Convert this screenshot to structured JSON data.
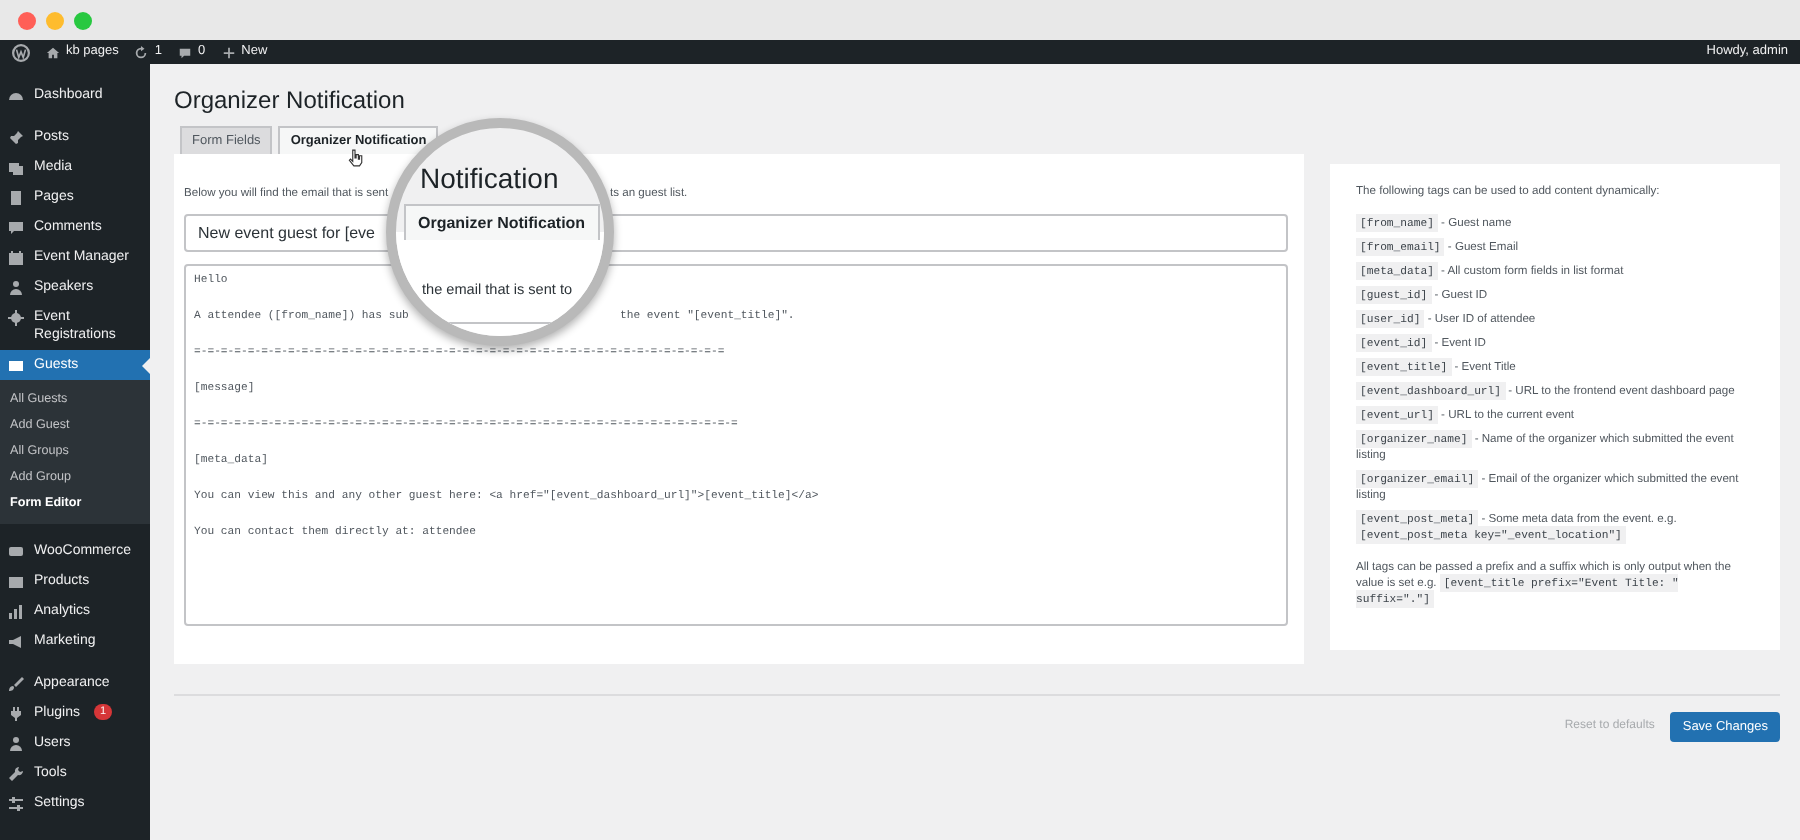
{
  "window": {
    "controls": [
      {
        "kind": "close"
      },
      {
        "kind": "minimize"
      },
      {
        "kind": "maximize"
      }
    ]
  },
  "admin_bar": {
    "site": "kb pages",
    "updates": "1",
    "comments": "0",
    "new": "New",
    "greeting": "Howdy, admin"
  },
  "sidebar": {
    "sections": [
      [
        {
          "label": "Dashboard",
          "selected": false
        }
      ],
      [
        {
          "label": "Posts",
          "selected": false
        },
        {
          "label": "Media",
          "selected": false
        },
        {
          "label": "Pages",
          "selected": false
        },
        {
          "label": "Comments",
          "selected": false
        },
        {
          "label": "Event Manager",
          "selected": false
        },
        {
          "label": "Speakers",
          "selected": false
        },
        {
          "label": "Event Registrations",
          "selected": false
        },
        {
          "label": "Guests",
          "selected": true,
          "children": [
            {
              "label": "All Guests",
              "selected": false
            },
            {
              "label": "Add Guest",
              "selected": false
            },
            {
              "label": "All Groups",
              "selected": false
            },
            {
              "label": "Add Group",
              "selected": false
            },
            {
              "label": "Form Editor",
              "selected": true
            }
          ]
        }
      ],
      [
        {
          "label": "WooCommerce",
          "selected": false
        },
        {
          "label": "Products",
          "selected": false
        },
        {
          "label": "Analytics",
          "selected": false
        },
        {
          "label": "Marketing",
          "selected": false
        }
      ],
      [
        {
          "label": "Appearance",
          "selected": false
        },
        {
          "label": "Plugins",
          "selected": false,
          "badge": "1"
        },
        {
          "label": "Users",
          "selected": false
        },
        {
          "label": "Tools",
          "selected": false
        },
        {
          "label": "Settings",
          "selected": false
        }
      ]
    ]
  },
  "page": {
    "title": "Organizer Notification",
    "tabs": [
      {
        "label": "Form Fields",
        "selected": false
      },
      {
        "label": "Organizer Notification",
        "selected": true
      }
    ],
    "description": [
      "Below you will find the email that is sent",
      "ts an guest list."
    ],
    "subject": "New event guest for [eve",
    "body_lines": [
      [
        "Hello"
      ],
      [
        "A attendee ([from_name]) has sub",
        "the event \"[event_title]\"."
      ],
      [
        "=-=-=-=-=-=-=-=-=-=-=-=-=-=-=-=-=-=-=-=-=-=-=-=-=-=-=-=-=-=-=-=-=-=-=-=-=-=-=-="
      ],
      [
        "[message]"
      ],
      [
        "=-=-=-=-=-=-=-=-=-=-=-=-=-=-=-=-=-=-=-=-=-=-=-=-=-=-=-=-=-=-=-=-=-=-=-=-=-=-=-=-="
      ],
      [
        "[meta_data]"
      ],
      [
        "You can view this and any other guest here: <a href=\"[event_dashboard_url]\">[event_title]</a>"
      ],
      [
        "You can contact them directly at: attendee"
      ]
    ],
    "magnifier": {
      "heading": "Notification",
      "tab": "Organizer Notification",
      "text": "the email that is sent to"
    }
  },
  "help": {
    "intro": "The following tags can be used to add content dynamically:",
    "tags": [
      {
        "code": "[from_name]",
        "text": "- Guest name"
      },
      {
        "code": "[from_email]",
        "text": "- Guest Email"
      },
      {
        "code": "[meta_data]",
        "text": "- All custom form fields in list format"
      },
      {
        "code": "[guest_id]",
        "text": "- Guest ID"
      },
      {
        "code": "[user_id]",
        "text": "- User ID of attendee"
      },
      {
        "code": "[event_id]",
        "text": "- Event ID"
      },
      {
        "code": "[event_title]",
        "text": "- Event Title"
      },
      {
        "code": "[event_dashboard_url]",
        "text": "- URL to the frontend event dashboard page"
      },
      {
        "code": "[event_url]",
        "text": "- URL to the current event"
      },
      {
        "code": "[organizer_name]",
        "text": "- Name of the organizer which submitted the event listing"
      },
      {
        "code": "[organizer_email]",
        "text": "- Email of the organizer which submitted the event listing"
      },
      {
        "code": "[event_post_meta]",
        "text": "- Some meta data from the event. e.g.",
        "code2": "[event_post_meta key=\"_event_location\"]"
      }
    ],
    "note": "All tags can be passed a prefix and a suffix which is only output when the value is set e.g.",
    "note_code": "[event_title prefix=\"Event Title: \" suffix=\".\"]"
  },
  "footer": {
    "reset": "Reset to defaults",
    "save": "Save Changes"
  }
}
